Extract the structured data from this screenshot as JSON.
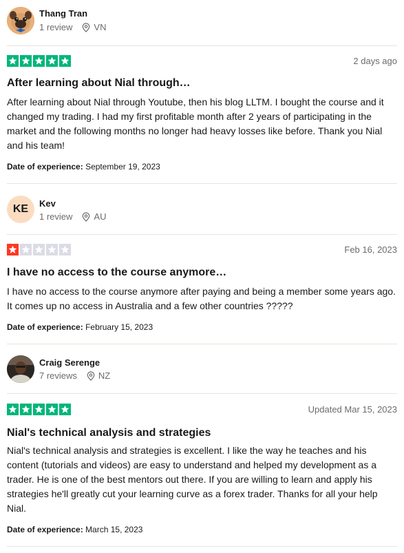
{
  "reviews": [
    {
      "user_name": "Thang Tran",
      "review_count": "1 review",
      "country": "VN",
      "rating": 5,
      "date": "2 days ago",
      "title": "After learning about Nial through…",
      "body": "After learning about Nial through Youtube, then his blog LLTM. I bought the course and it changed my trading. I had my first profitable month after 2 years of participating in the market and the following months no longer had heavy losses like before. Thank you Nial and his team!",
      "experience_label": "Date of experience:",
      "experience_date": "September 19, 2023"
    },
    {
      "user_name": "Kev",
      "avatar_initials": "KE",
      "review_count": "1 review",
      "country": "AU",
      "rating": 1,
      "date": "Feb 16, 2023",
      "title": "I have no access to the course anymore…",
      "body": "I have no access to the course anymore after paying and being a member some years ago. It comes up no access in Australia and a few other countries ?????",
      "experience_label": "Date of experience:",
      "experience_date": "February 15, 2023"
    },
    {
      "user_name": "Craig Serenge",
      "review_count": "7 reviews",
      "country": "NZ",
      "rating": 5,
      "date": "Updated Mar 15, 2023",
      "title": "Nial's technical analysis and strategies",
      "body": "Nial's technical analysis and strategies is excellent. I like the way he teaches and his content (tutorials and videos) are easy to understand and helped my development as a trader. He is one of the best mentors out there. If you are willing to learn and apply his strategies he'll greatly cut your learning curve as a forex trader. Thanks for all your help Nial.",
      "experience_label": "Date of experience:",
      "experience_date": "March 15, 2023"
    }
  ],
  "colors": {
    "five_star": "#00b67a",
    "one_star": "#ff3722",
    "empty_star": "#dcdce6",
    "initials_bg": "#fcdcc1"
  }
}
